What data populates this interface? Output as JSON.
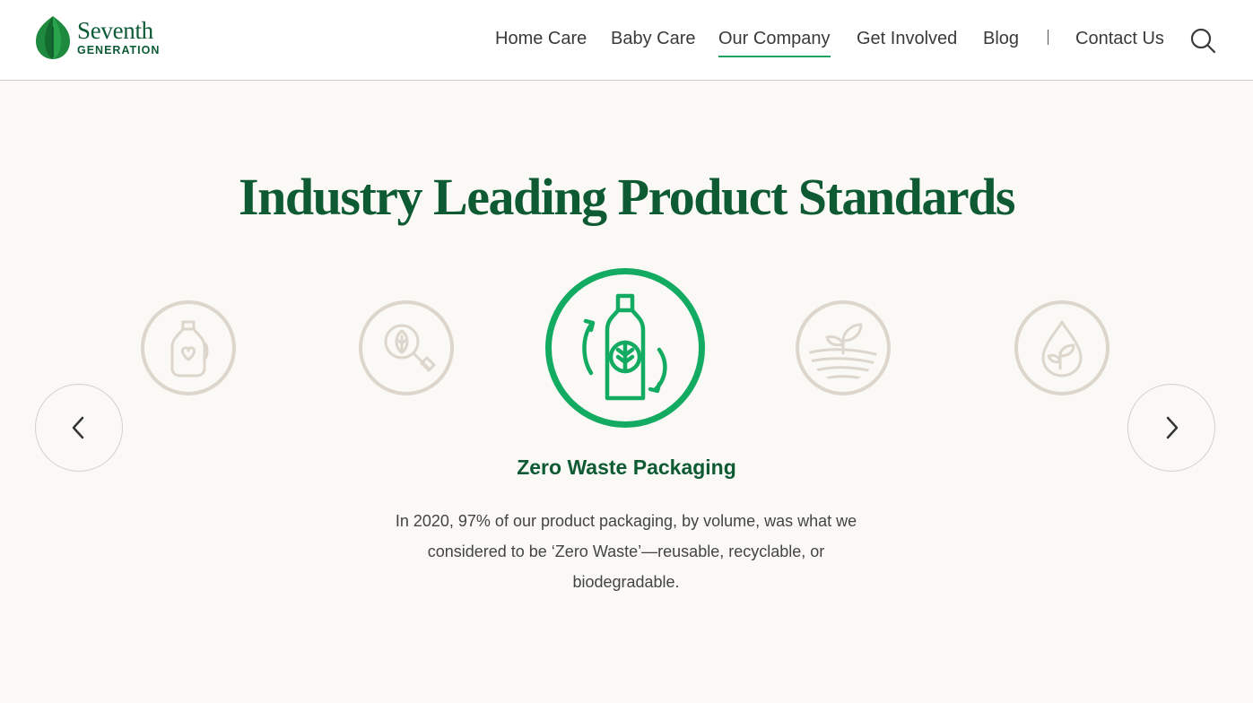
{
  "brand": {
    "name": "Seventh",
    "sub": "GENERATION"
  },
  "nav": {
    "items": [
      {
        "label": "Home Care"
      },
      {
        "label": "Baby Care"
      },
      {
        "label": "Our Company",
        "active": true
      },
      {
        "label": "Get Involved"
      },
      {
        "label": "Blog"
      },
      {
        "label": "Contact Us"
      }
    ],
    "search_icon": "search-icon"
  },
  "section": {
    "title": "Industry Leading Product Standards",
    "carousel": {
      "icons": [
        {
          "name": "detergent-bottle-heart-icon",
          "active": false
        },
        {
          "name": "leaf-magnifier-icon",
          "active": false
        },
        {
          "name": "recycle-bottle-leaf-icon",
          "active": true
        },
        {
          "name": "sprout-field-icon",
          "active": false
        },
        {
          "name": "water-drop-sprout-icon",
          "active": false
        }
      ],
      "prev_icon": "chevron-left-icon",
      "next_icon": "chevron-right-icon"
    },
    "feature": {
      "title": "Zero Waste Packaging",
      "description": "In 2020, 97% of our product packaging, by volume, was what we considered to be ‘Zero Waste’—reusable, recyclable, or biodegradable."
    }
  },
  "colors": {
    "brand_green": "#0d5a33",
    "accent_green": "#13ab61",
    "inactive_icon": "#ddd6cc",
    "background": "#faf9f5"
  }
}
